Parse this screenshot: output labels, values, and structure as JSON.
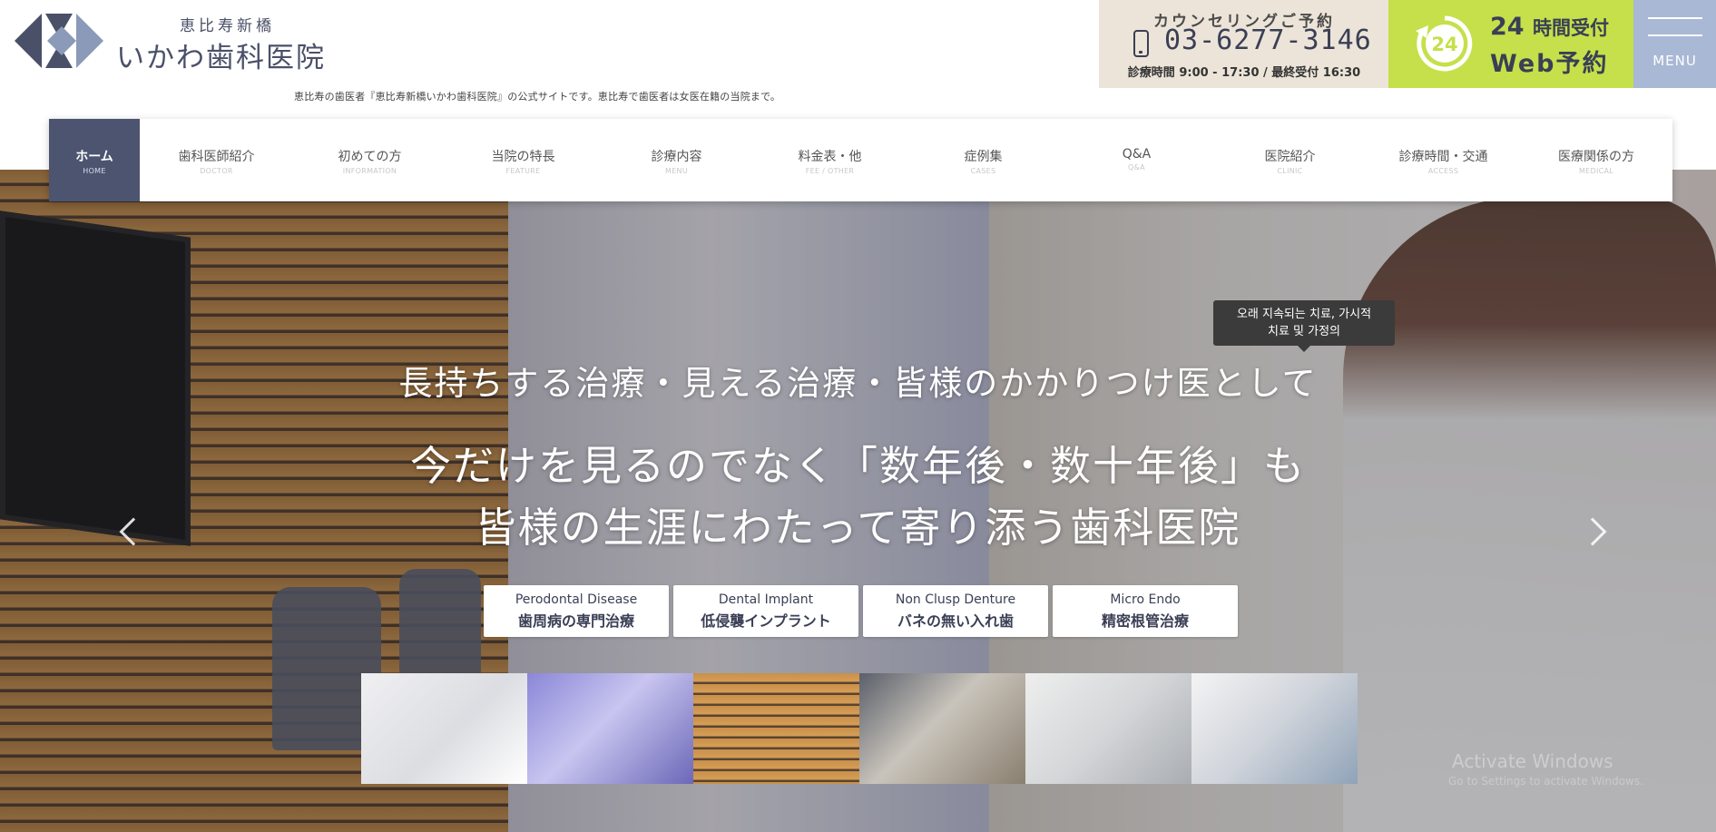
{
  "header": {
    "logo_sub": "恵比寿新橋",
    "logo_main": "いかわ歯科医院",
    "tagline": "恵比寿の歯医者『恵比寿新橋いかわ歯科医院』の公式サイトです。恵比寿で歯医者は女医在籍の当院まで。",
    "tel": {
      "title": "カウンセリングご予約",
      "number": "03-6277-3146",
      "hours": "診療時間 9:00 - 17:30 / 最終受付 16:30"
    },
    "web": {
      "badge": "24",
      "line1_num": "24",
      "line1_text": "時間受付",
      "line2": "Web予約"
    },
    "menu_label": "MENU"
  },
  "nav": {
    "items": [
      {
        "ja": "ホーム",
        "en": "HOME",
        "active": true
      },
      {
        "ja": "歯科医師紹介",
        "en": "DOCTOR"
      },
      {
        "ja": "初めての方",
        "en": "INFORMATION"
      },
      {
        "ja": "当院の特長",
        "en": "FEATURE"
      },
      {
        "ja": "診療内容",
        "en": "MENU"
      },
      {
        "ja": "料金表・他",
        "en": "FEE / OTHER"
      },
      {
        "ja": "症例集",
        "en": "CASES"
      },
      {
        "ja": "Q&A",
        "en": "Q&A"
      },
      {
        "ja": "医院紹介",
        "en": "CLINIC"
      },
      {
        "ja": "診療時間・交通",
        "en": "ACCESS"
      },
      {
        "ja": "医療関係の方",
        "en": "MEDICAL"
      }
    ]
  },
  "hero": {
    "sub": "長持ちする治療・見える治療・皆様のかかりつけ医として",
    "main_line1": "今だけを見るのでなく「数年後・数十年後」も",
    "main_line2": "皆様の生涯にわたって寄り添う歯科医院",
    "tooltip_line1": "오래 지속되는 치료, 가시적",
    "tooltip_line2": "치료 및 가정의",
    "specialties": [
      {
        "en": "Perodontal Disease",
        "ja": "歯周病の専門治療"
      },
      {
        "en": "Dental Implant",
        "ja": "低侵襲インプラント"
      },
      {
        "en": "Non Clusp Denture",
        "ja": "バネの無い入れ歯"
      },
      {
        "en": "Micro Endo",
        "ja": "精密根管治療"
      }
    ],
    "thumbnails": [
      "counseling-room",
      "ct-scanner",
      "waiting-room",
      "entrance",
      "treatment-unit",
      "treatment-room"
    ],
    "watermark": "Activate Windows",
    "watermark_sub": "Go to Settings to activate Windows."
  },
  "colors": {
    "navy": "#4d5470",
    "accent_green": "#c5e04a",
    "beige": "#ece4d8",
    "menu_blue": "#a9b8d4"
  }
}
